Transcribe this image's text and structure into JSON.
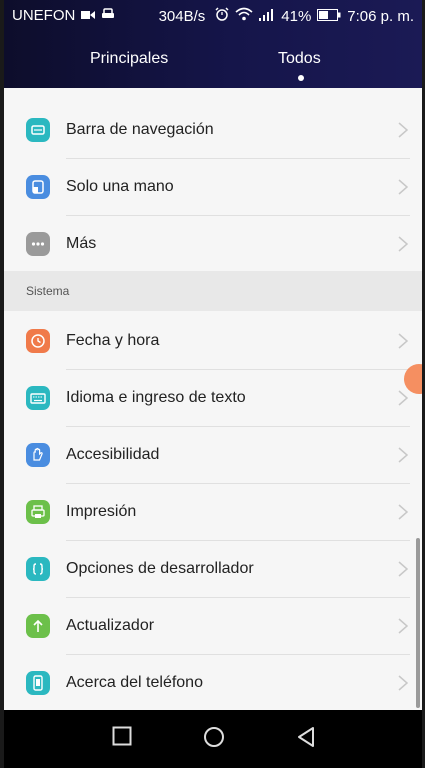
{
  "status": {
    "carrier": "UNEFON",
    "speed": "304B/s",
    "battery": "41%",
    "time": "7:06 p. m."
  },
  "tabs": [
    {
      "label": "Principales",
      "active": false
    },
    {
      "label": "Todos",
      "active": true
    }
  ],
  "items_top": [
    {
      "label": "Barra de navegación",
      "icon": "navigation-bar-icon",
      "color": "#2bb8c0"
    },
    {
      "label": "Solo una mano",
      "icon": "one-hand-icon",
      "color": "#4a8de0"
    },
    {
      "label": "Más",
      "icon": "more-icon",
      "color": "#9a9a9a"
    }
  ],
  "section": {
    "label": "Sistema"
  },
  "items_system": [
    {
      "label": "Fecha y hora",
      "icon": "clock-icon",
      "color": "#f07a4a"
    },
    {
      "label": "Idioma e ingreso de texto",
      "icon": "keyboard-icon",
      "color": "#2bb8c0"
    },
    {
      "label": "Accesibilidad",
      "icon": "hand-icon",
      "color": "#4a8de0"
    },
    {
      "label": "Impresión",
      "icon": "printer-icon",
      "color": "#6cc04a"
    },
    {
      "label": "Opciones de desarrollador",
      "icon": "braces-icon",
      "color": "#2bb8c0"
    },
    {
      "label": "Actualizador",
      "icon": "arrow-up-icon",
      "color": "#6cc04a"
    },
    {
      "label": "Acerca del teléfono",
      "icon": "phone-icon",
      "color": "#2bb8c0"
    }
  ]
}
